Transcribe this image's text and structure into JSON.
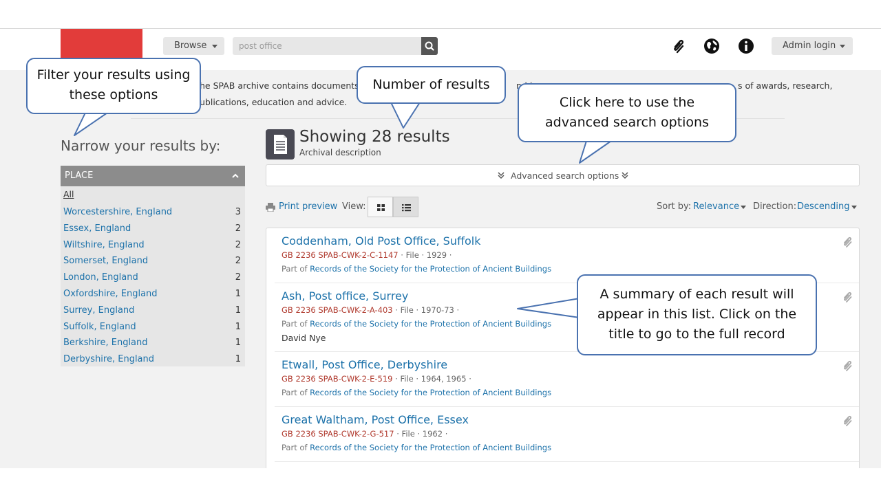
{
  "header": {
    "browse_label": "Browse",
    "search_value": "post office",
    "admin_label": "Admin login"
  },
  "intro": {
    "line1a": "he SPAB archive contains documents",
    "line1b": "nd i",
    "line1c": "s of awards, research,",
    "line2": "ublications, education and advice."
  },
  "sidebar": {
    "title": "Narrow your results by:",
    "facet": {
      "heading": "PLACE",
      "all_label": "All",
      "items": [
        {
          "label": "Worcestershire, England",
          "count": "3"
        },
        {
          "label": "Essex, England",
          "count": "2"
        },
        {
          "label": "Wiltshire, England",
          "count": "2"
        },
        {
          "label": "Somerset, England",
          "count": "2"
        },
        {
          "label": "London, England",
          "count": "2"
        },
        {
          "label": "Oxfordshire, England",
          "count": "1"
        },
        {
          "label": "Surrey, England",
          "count": "1"
        },
        {
          "label": "Suffolk, England",
          "count": "1"
        },
        {
          "label": "Berkshire, England",
          "count": "1"
        },
        {
          "label": "Derbyshire, England",
          "count": "1"
        }
      ]
    }
  },
  "main": {
    "showing": "Showing 28 results",
    "subtitle": "Archival description",
    "advanced_label": "Advanced search options",
    "print_label": "Print preview",
    "view_label": "View:",
    "sort_label": "Sort by:",
    "sort_value": "Relevance",
    "direction_label": "Direction:",
    "direction_value": "Descending"
  },
  "results": [
    {
      "title": "Coddenham, Old Post Office, Suffolk",
      "ref": "GB 2236 SPAB-CWK-2-C-1147",
      "level": "File",
      "date": "1929",
      "part_of": "Part of",
      "collection": "Records of the Society for the Protection of Ancient Buildings",
      "creator": ""
    },
    {
      "title": "Ash, Post office, Surrey",
      "ref": "GB 2236 SPAB-CWK-2-A-403",
      "level": "File",
      "date": "1970-73",
      "part_of": "Part of",
      "collection": "Records of the Society for the Protection of Ancient Buildings",
      "creator": "David Nye"
    },
    {
      "title": "Etwall, Post Office, Derbyshire",
      "ref": "GB 2236 SPAB-CWK-2-E-519",
      "level": "File",
      "date": "1964, 1965",
      "part_of": "Part of",
      "collection": "Records of the Society for the Protection of Ancient Buildings",
      "creator": ""
    },
    {
      "title": "Great Waltham, Post Office, Essex",
      "ref": "GB 2236 SPAB-CWK-2-G-517",
      "level": "File",
      "date": "1962",
      "part_of": "Part of",
      "collection": "Records of the Society for the Protection of Ancient Buildings",
      "creator": ""
    }
  ],
  "callouts": {
    "filter": "Filter your results using these options",
    "number": "Number of results",
    "advanced": "Click here to use the advanced search options",
    "summary": "A summary of each result will appear in this list. Click on the title to go to the full record"
  },
  "colors": {
    "link": "#1d72aa",
    "reference": "#b03a2e",
    "logo": "#e23c3a",
    "callout_border": "#4a72b0"
  }
}
